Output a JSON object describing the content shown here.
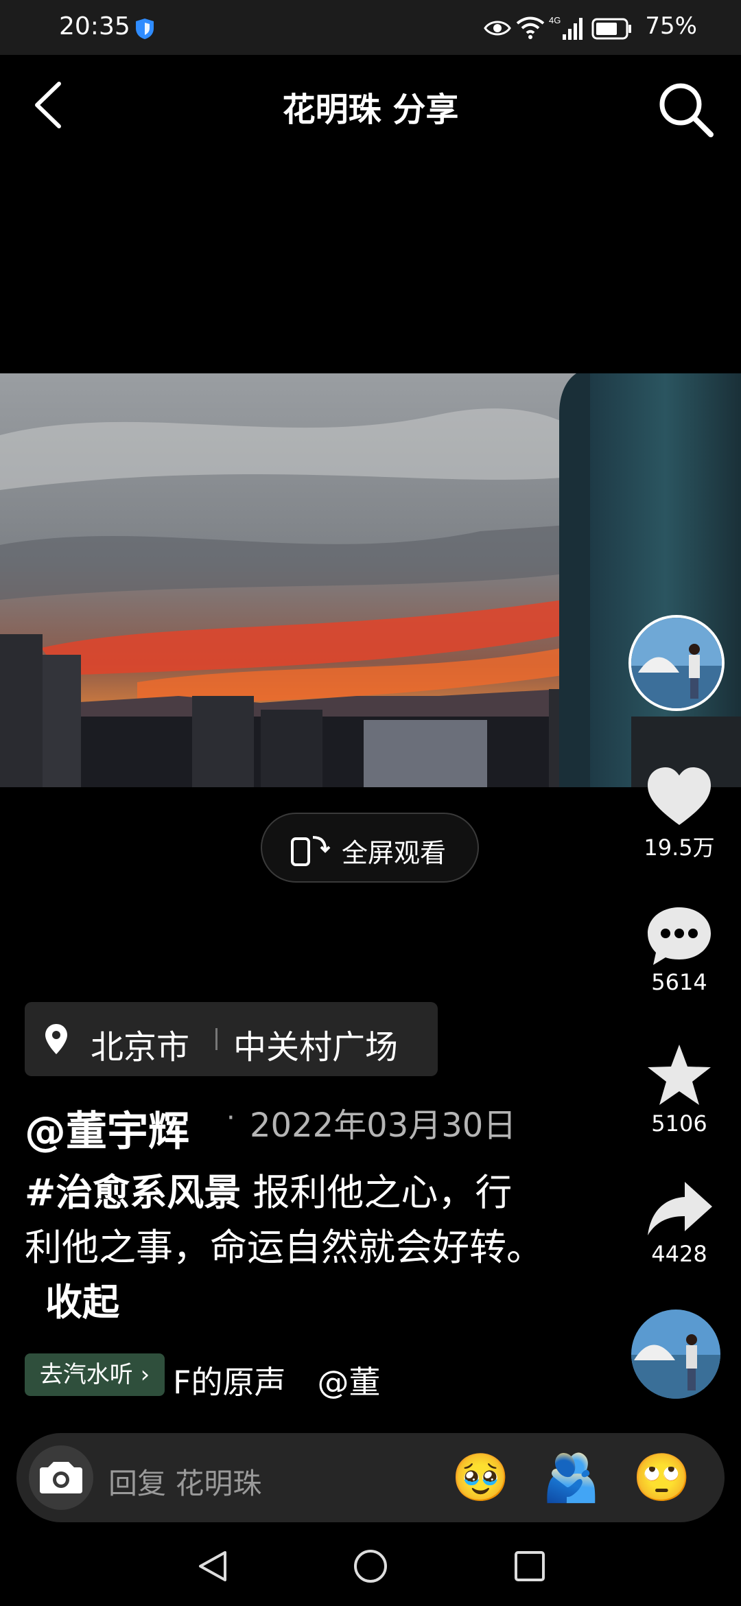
{
  "status_bar": {
    "time": "20:35",
    "network": "4G",
    "battery": "75%"
  },
  "header": {
    "title": "花明珠 分享"
  },
  "video": {
    "fullscreen_label": "全屏观看"
  },
  "rail": {
    "likes": "19.5万",
    "comments": "5614",
    "favorites": "5106",
    "shares": "4428"
  },
  "post": {
    "location_city": "北京市",
    "location_place": "中关村广场",
    "author": "@董宇辉",
    "date_dot": "·",
    "date": "2022年03月30日",
    "hashtag": "#治愈系风景",
    "caption": " 报利他之心，行利他之事，命运自然就会好转。",
    "collapse_label": "收起",
    "music_chip": "去汽水听 ›",
    "music_text": "F的原声　@董"
  },
  "reply": {
    "placeholder": "回复 花明珠",
    "emojis": [
      "🥹",
      "🫂",
      "🙄"
    ]
  },
  "colors": {
    "background": "#000000",
    "status_bar": "#1c1c1c",
    "chip_bg": "#262626",
    "music_chip_bg": "#2f4f3c"
  }
}
